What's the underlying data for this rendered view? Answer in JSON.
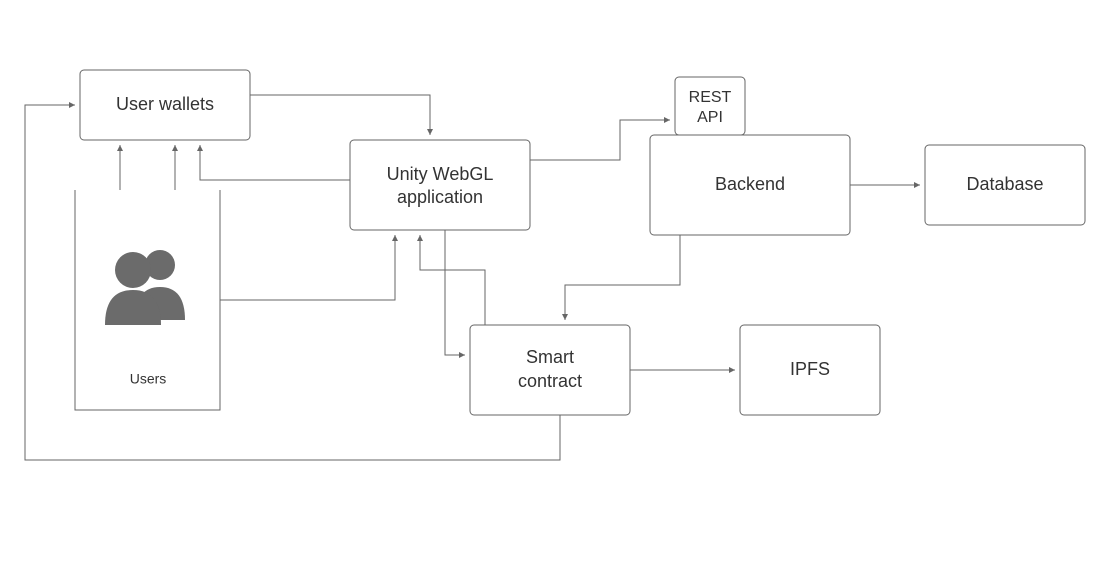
{
  "diagram": {
    "nodes": {
      "user_wallets": "User wallets",
      "unity_webgl_l1": "Unity WebGL",
      "unity_webgl_l2": "application",
      "rest_api_l1": "REST",
      "rest_api_l2": "API",
      "backend": "Backend",
      "database": "Database",
      "smart_contract_l1": "Smart",
      "smart_contract_l2": "contract",
      "ipfs": "IPFS",
      "users": "Users"
    }
  }
}
